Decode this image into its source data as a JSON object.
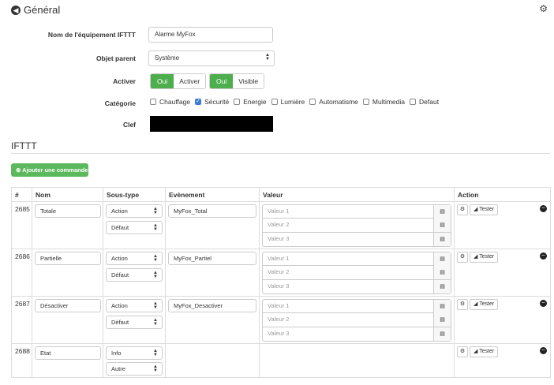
{
  "header": {
    "title": "Général"
  },
  "form": {
    "name_label": "Nom de l'équipement IFTTT",
    "name_value": "Alarme MyFox",
    "parent_label": "Objet parent",
    "parent_value": "Système",
    "activer_label": "Activer",
    "activer_on": "Oui",
    "activer_off": "Activer",
    "visible_on": "Oui",
    "visible_off": "Visible",
    "category_label": "Catégorie",
    "categories": [
      {
        "label": "Chauffage",
        "checked": false
      },
      {
        "label": "Sécurité",
        "checked": true
      },
      {
        "label": "Energie",
        "checked": false
      },
      {
        "label": "Lumière",
        "checked": false
      },
      {
        "label": "Automatisme",
        "checked": false
      },
      {
        "label": "Multimedia",
        "checked": false
      },
      {
        "label": "Defaut",
        "checked": false
      }
    ],
    "clef_label": "Clef"
  },
  "section": {
    "title": "IFTTT",
    "add_button": "Ajouter une commande"
  },
  "table": {
    "headers": [
      "#",
      "Nom",
      "Sous-type",
      "Evènement",
      "Valeur",
      "Action"
    ],
    "rows": [
      {
        "id": "2685",
        "name": "Totale",
        "type": "Action",
        "subtype": "Défaut",
        "event": "MyFox_Total",
        "values": [
          "Valeur 1",
          "Valeur 2",
          "Valeur 3"
        ],
        "test": "Tester"
      },
      {
        "id": "2686",
        "name": "Partielle",
        "type": "Action",
        "subtype": "Défaut",
        "event": "MyFox_Partiel",
        "values": [
          "Valeur 1",
          "Valeur 2",
          "Valeur 3"
        ],
        "test": "Tester"
      },
      {
        "id": "2687",
        "name": "Désactiver",
        "type": "Action",
        "subtype": "Défaut",
        "event": "MyFox_Desactiver",
        "values": [
          "Valeur 1",
          "Valeur 2",
          "Valeur 3"
        ],
        "test": "Tester"
      },
      {
        "id": "2688",
        "name": "Etat",
        "type": "Info",
        "subtype": "Autre",
        "event": "",
        "values": [],
        "test": "Tester"
      }
    ]
  },
  "colors": {
    "primary_green": "#5cb85c",
    "checkbox_blue": "#3b7dd8",
    "secret_box": "#000000"
  },
  "icons": {
    "back": "arrow-left-circle-icon",
    "config": "gears-icon",
    "add": "plus-circle-icon",
    "calendar": "list-icon",
    "rss": "rss-icon",
    "remove": "minus-circle-icon"
  }
}
